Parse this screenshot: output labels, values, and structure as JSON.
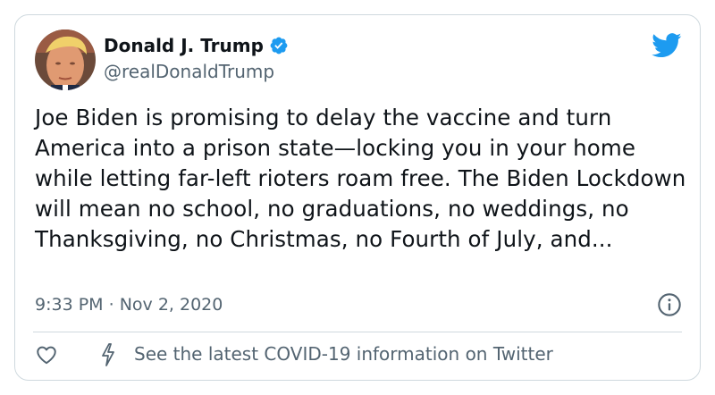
{
  "tweet": {
    "author": {
      "display_name": "Donald J. Trump",
      "handle": "@realDonaldTrump",
      "verified": true
    },
    "text": "Joe Biden is promising to delay the vaccine and turn America into a prison state—locking you in your home while letting far-left rioters roam free. The Biden Lockdown will mean no school, no graduations, no weddings, no Thanksgiving, no Christmas, no Fourth of July, and...",
    "time": "9:33 PM",
    "separator": "·",
    "date": "Nov 2, 2020",
    "notice": "See the latest COVID-19 information on Twitter"
  },
  "icons": {
    "brand": "twitter-bird-icon",
    "verified": "verified-badge-icon",
    "info": "info-icon",
    "like": "heart-icon",
    "notice": "flash-icon"
  },
  "colors": {
    "twitter_blue": "#1d9bf0",
    "text_primary": "#0f1419",
    "text_secondary": "#536471",
    "border": "#cfd9de"
  }
}
